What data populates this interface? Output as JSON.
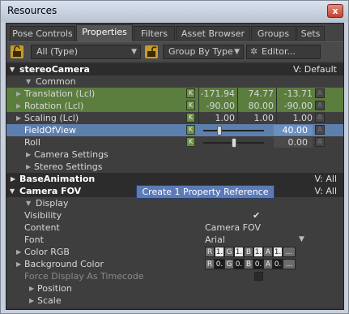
{
  "window": {
    "title": "Resources",
    "close_label": "x"
  },
  "tabs": [
    "Pose Controls",
    "Properties",
    "Filters",
    "Asset Browser",
    "Groups",
    "Sets"
  ],
  "active_tab": "Properties",
  "toolbar": {
    "filter_value": "All (Type)",
    "group_value": "Group By Type",
    "editor_label": "Editor..."
  },
  "sections": {
    "stereo_camera": {
      "title": "stereoCamera",
      "version": "V: Default"
    },
    "common": "Common",
    "translation": {
      "label": "Translation (Lcl)",
      "k": "K",
      "x": "-171.94",
      "y": "74.77",
      "z": "-13.71",
      "a": "A"
    },
    "rotation": {
      "label": "Rotation (Lcl)",
      "k": "K",
      "x": "-90.00",
      "y": "80.00",
      "z": "-90.00",
      "a": "A"
    },
    "scaling": {
      "label": "Scaling (Lcl)",
      "k": "K",
      "x": "1.00",
      "y": "1.00",
      "z": "1.00",
      "a": "A"
    },
    "fov": {
      "label": "FieldOfView",
      "k": "K",
      "value": "40.00",
      "a": "A",
      "slider_fraction": 0.25
    },
    "roll": {
      "label": "Roll",
      "k": "K",
      "value": "0.00",
      "a": "A",
      "slider_fraction": 0.5
    },
    "camera_settings": "Camera Settings",
    "stereo_settings": "Stereo Settings",
    "base_animation": {
      "title": "BaseAnimation",
      "version": "V: All"
    },
    "camera_fov": {
      "title": "Camera FOV",
      "version": "V: All"
    },
    "display": "Display",
    "visibility": {
      "label": "Visibility",
      "check": "✔"
    },
    "content": {
      "label": "Content",
      "value": "Camera FOV"
    },
    "font": {
      "label": "Font",
      "value": "Arial"
    },
    "color_rgb": {
      "label": "Color RGB",
      "r": "R",
      "rv": "1.",
      "g": "G",
      "gv": "1.",
      "b": "B",
      "bv": "1.",
      "a": "A",
      "av": "1.",
      "more": "..."
    },
    "background_color": {
      "label": "Background Color",
      "r": "R",
      "rv": "0.",
      "g": "G",
      "gv": "0.",
      "b": "B",
      "bv": "0.",
      "a": "A",
      "av": "0.",
      "more": "..."
    },
    "force_display": "Force Display As Timecode",
    "position": "Position",
    "scale": "Scale"
  },
  "tooltip": "Create 1 Property Reference"
}
